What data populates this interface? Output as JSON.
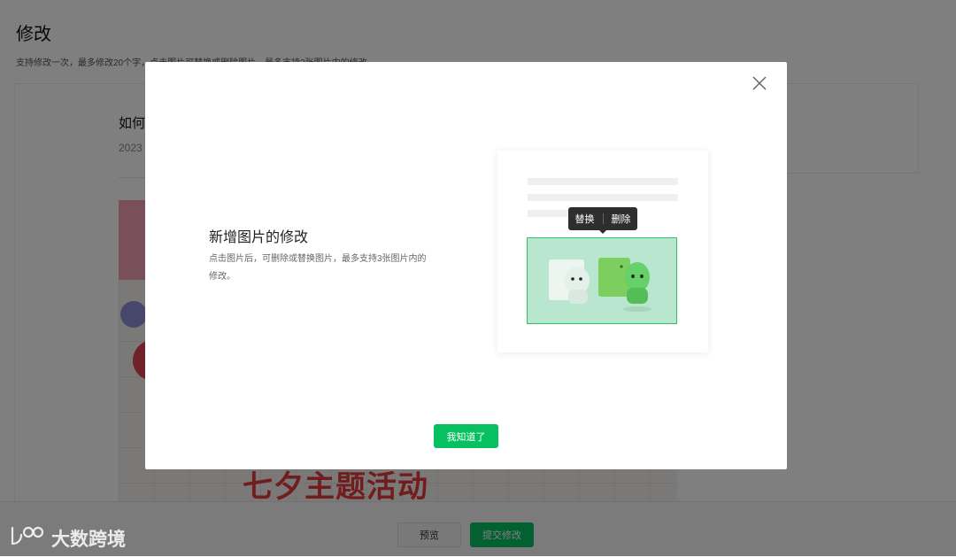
{
  "page": {
    "title": "修改",
    "subtitle": "支持修改一次，最多修改20个字，点击图片可替换或删除图片，最多支持3张图片内的修改",
    "article": {
      "title_partial": "如何",
      "date_partial": "2023",
      "headline": "七夕主题活动"
    },
    "footer": {
      "preview_label": "预览",
      "submit_label": "提交修改"
    }
  },
  "dialog": {
    "heading": "新增图片的修改",
    "description": "点击图片后，可删除或替换图片，最多支持3张图片内的修改。",
    "tooltip": {
      "replace_label": "替换",
      "delete_label": "删除"
    },
    "confirm_label": "我知道了"
  },
  "watermark": {
    "text": "大数跨境"
  },
  "icons": {
    "close": "close-icon",
    "watermark_logo": "logo-icon"
  },
  "colors": {
    "primary_green": "#07c160",
    "overlay": "rgba(0,0,0,0.5)",
    "tooltip_bg": "#2e2e2e",
    "highlight_border": "#34bf66"
  }
}
